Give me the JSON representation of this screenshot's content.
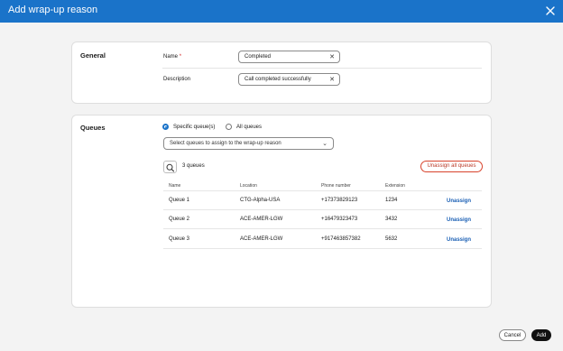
{
  "dialog": {
    "title": "Add wrap-up reason"
  },
  "general": {
    "section_title": "General",
    "name_label": "Name",
    "name_required_mark": "*",
    "name_value": "Completed",
    "description_label": "Description",
    "description_value": "Call completed successfully"
  },
  "queues": {
    "section_title": "Queues",
    "radio_specific": "Specific queue(s)",
    "radio_all": "All queues",
    "selected_option": "specific",
    "select_placeholder": "Select queues to assign to the wrap-up reason",
    "count_text": "3 queues",
    "unassign_all_label": "Unassign all queues",
    "columns": [
      "Name",
      "Location",
      "Phone number",
      "Extension"
    ],
    "rows": [
      {
        "name": "Queue 1",
        "location": "CTG-Alpha-USA",
        "phone": "+17373829123",
        "extension": "1234",
        "action": "Unassign"
      },
      {
        "name": "Queue 2",
        "location": "ACE-AMER-LGW",
        "phone": "+16479323473",
        "extension": "3432",
        "action": "Unassign"
      },
      {
        "name": "Queue 3",
        "location": "ACE-AMER-LGW",
        "phone": "+917463857382",
        "extension": "5632",
        "action": "Unassign"
      }
    ]
  },
  "footer": {
    "cancel_label": "Cancel",
    "add_label": "Add"
  },
  "colors": {
    "header": "#1a73c9",
    "accent": "#1a73c9",
    "danger": "#d8432c",
    "link": "#1a5fb4"
  }
}
